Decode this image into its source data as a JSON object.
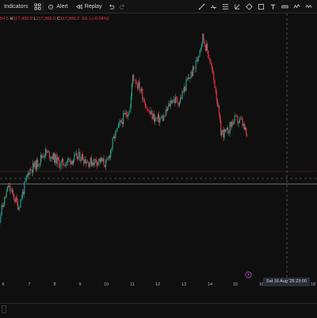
{
  "toolbar": {
    "indicators_label": "Indicators",
    "alert_label": "Alert",
    "replay_label": "Replay"
  },
  "legend": {
    "partial_prefix": "54.5",
    "high_label": "H",
    "high_value": "117,420.0",
    "low_label": "L",
    "low_value": "117,306.0",
    "close_label": "C",
    "close_value": "117,306.2",
    "change_value": "-50.1 (-0.04%)"
  },
  "colors": {
    "up": "#22ab94",
    "down": "#f23645",
    "background": "#0f0f0f",
    "crosshair": "#7a7a7a",
    "last_price_line": "#f23645"
  },
  "xaxis": {
    "ticks": [
      "6",
      "7",
      "8",
      "9",
      "10",
      "11",
      "12",
      "13",
      "14",
      "15",
      "16",
      "18"
    ],
    "cursor_label": "Sat 16 Aug '25   23:00"
  },
  "chart_data": {
    "type": "candlestick",
    "x_unit": "day of August 2025",
    "y_unit": "price (unlabeled, relative level 0-100)",
    "closes": [
      {
        "day": 5.8,
        "close": 20
      },
      {
        "day": 6.2,
        "close": 38
      },
      {
        "day": 6.6,
        "close": 28
      },
      {
        "day": 7.0,
        "close": 46
      },
      {
        "day": 7.3,
        "close": 49
      },
      {
        "day": 7.6,
        "close": 55
      },
      {
        "day": 7.9,
        "close": 53
      },
      {
        "day": 8.2,
        "close": 49
      },
      {
        "day": 8.6,
        "close": 51
      },
      {
        "day": 9.0,
        "close": 53
      },
      {
        "day": 9.3,
        "close": 50
      },
      {
        "day": 9.7,
        "close": 51
      },
      {
        "day": 10.0,
        "close": 49
      },
      {
        "day": 10.3,
        "close": 63
      },
      {
        "day": 10.6,
        "close": 71
      },
      {
        "day": 10.9,
        "close": 77
      },
      {
        "day": 11.0,
        "close": 93
      },
      {
        "day": 11.3,
        "close": 86
      },
      {
        "day": 11.6,
        "close": 75
      },
      {
        "day": 11.9,
        "close": 71
      },
      {
        "day": 12.2,
        "close": 72
      },
      {
        "day": 12.5,
        "close": 81
      },
      {
        "day": 12.8,
        "close": 80
      },
      {
        "day": 13.1,
        "close": 90
      },
      {
        "day": 13.4,
        "close": 97
      },
      {
        "day": 13.7,
        "close": 112
      },
      {
        "day": 13.95,
        "close": 102
      },
      {
        "day": 14.2,
        "close": 86
      },
      {
        "day": 14.4,
        "close": 65
      },
      {
        "day": 14.6,
        "close": 64
      },
      {
        "day": 14.9,
        "close": 71
      },
      {
        "day": 15.2,
        "close": 70
      },
      {
        "day": 15.45,
        "close": 61
      }
    ]
  }
}
